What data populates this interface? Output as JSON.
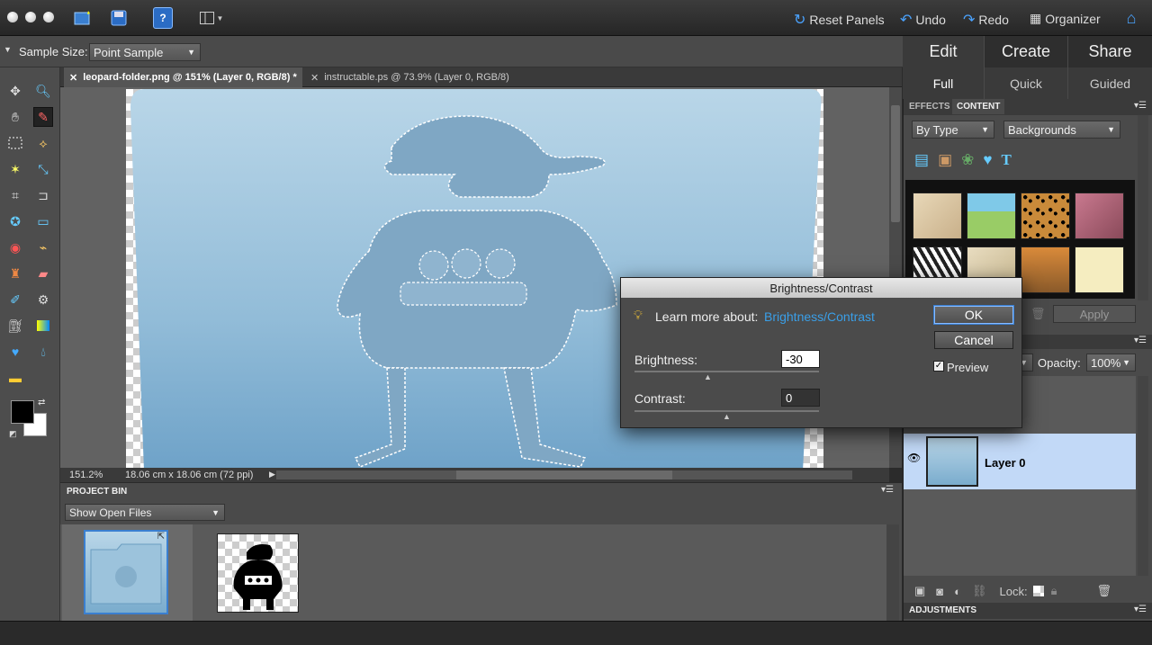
{
  "app": {
    "accent": "#3a9fe8",
    "selection_color": "#c2d9f7"
  },
  "topbar": {
    "reset_panels": "Reset Panels",
    "undo": "Undo",
    "redo": "Redo",
    "organizer": "Organizer"
  },
  "options": {
    "sample_size_label": "Sample Size:",
    "sample_size_value": "Point Sample"
  },
  "doc_tabs": [
    {
      "label": "leopard-folder.png @ 151% (Layer 0, RGB/8) *",
      "active": true
    },
    {
      "label": "instructable.ps @ 73.9% (Layer 0, RGB/8)",
      "active": false
    }
  ],
  "status": {
    "zoom": "151.2%",
    "doc_size": "18.06 cm x 18.06 cm (72 ppi)"
  },
  "project_bin": {
    "title": "PROJECT BIN",
    "filter": "Show Open Files"
  },
  "modes": {
    "edit": "Edit",
    "create": "Create",
    "share": "Share",
    "full": "Full",
    "quick": "Quick",
    "guided": "Guided"
  },
  "content_panel": {
    "tab_effects": "EFFECTS",
    "tab_content": "CONTENT",
    "by_type": "By Type",
    "category": "Backgrounds",
    "apply": "Apply",
    "thumbs": [
      {
        "name": "africa-map"
      },
      {
        "name": "kids-drawing"
      },
      {
        "name": "leopard"
      },
      {
        "name": "pink-texture"
      },
      {
        "name": "zebra"
      },
      {
        "name": "world-map"
      },
      {
        "name": "autumn"
      },
      {
        "name": "cream-paper"
      }
    ]
  },
  "layers_panel": {
    "opacity_label": "Opacity:",
    "opacity_value": "100%",
    "layer_name": "Layer 0",
    "lock_label": "Lock:"
  },
  "adjustments": {
    "title": "ADJUSTMENTS"
  },
  "dialog": {
    "title": "Brightness/Contrast",
    "learn_label": "Learn more about:",
    "learn_link": "Brightness/Contrast",
    "ok": "OK",
    "cancel": "Cancel",
    "preview_label": "Preview",
    "preview_checked": true,
    "brightness_label": "Brightness:",
    "brightness_value": "-30",
    "contrast_label": "Contrast:",
    "contrast_value": "0"
  }
}
